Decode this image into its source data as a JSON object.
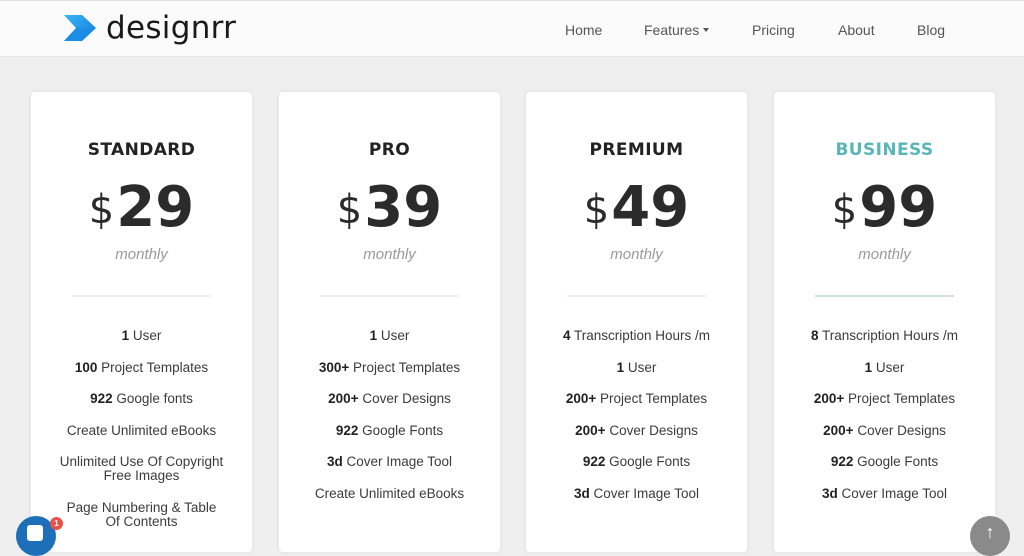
{
  "header": {
    "brand": "designrr",
    "nav": [
      {
        "label": "Home"
      },
      {
        "label": "Features",
        "has_dropdown": true
      },
      {
        "label": "Pricing"
      },
      {
        "label": "About"
      },
      {
        "label": "Blog"
      }
    ]
  },
  "colors": {
    "accent": "#5ab6b7",
    "logo_blue": "#1aa3e8",
    "chat_blue": "#1d6fb8",
    "badge_red": "#e5534b"
  },
  "plans": [
    {
      "name": "STANDARD",
      "currency": "$",
      "price": "29",
      "period": "monthly",
      "features": [
        {
          "bold": "1",
          "text": " User"
        },
        {
          "bold": "100",
          "text": " Project Templates"
        },
        {
          "bold": "922",
          "text": " Google fonts"
        },
        {
          "bold": "",
          "text": "Create Unlimited eBooks"
        },
        {
          "bold": "",
          "text": "Unlimited Use Of Copyright Free Images"
        },
        {
          "bold": "",
          "text": "Page Numbering & Table Of Contents"
        }
      ]
    },
    {
      "name": "PRO",
      "currency": "$",
      "price": "39",
      "period": "monthly",
      "features": [
        {
          "bold": "1",
          "text": " User"
        },
        {
          "bold": "300+",
          "text": " Project Templates"
        },
        {
          "bold": "200+",
          "text": " Cover Designs"
        },
        {
          "bold": "922",
          "text": " Google Fonts"
        },
        {
          "bold": "3d",
          "text": " Cover Image Tool"
        },
        {
          "bold": "",
          "text": "Create Unlimited eBooks"
        }
      ]
    },
    {
      "name": "PREMIUM",
      "currency": "$",
      "price": "49",
      "period": "monthly",
      "features": [
        {
          "bold": "4",
          "text": " Transcription Hours /m"
        },
        {
          "bold": "1",
          "text": " User"
        },
        {
          "bold": "200+",
          "text": " Project Templates"
        },
        {
          "bold": "200+",
          "text": " Cover Designs"
        },
        {
          "bold": "922",
          "text": " Google Fonts"
        },
        {
          "bold": "3d",
          "text": " Cover Image Tool"
        }
      ]
    },
    {
      "name": "BUSINESS",
      "currency": "$",
      "price": "99",
      "period": "monthly",
      "highlighted": true,
      "features": [
        {
          "bold": "8",
          "text": " Transcription Hours /m"
        },
        {
          "bold": "1",
          "text": " User"
        },
        {
          "bold": "200+",
          "text": " Project Templates"
        },
        {
          "bold": "200+",
          "text": " Cover Designs"
        },
        {
          "bold": "922",
          "text": " Google Fonts"
        },
        {
          "bold": "3d",
          "text": " Cover Image Tool"
        }
      ]
    }
  ],
  "widgets": {
    "chat_badge_count": "1",
    "scroll_top_icon": "arrow-up-icon"
  }
}
